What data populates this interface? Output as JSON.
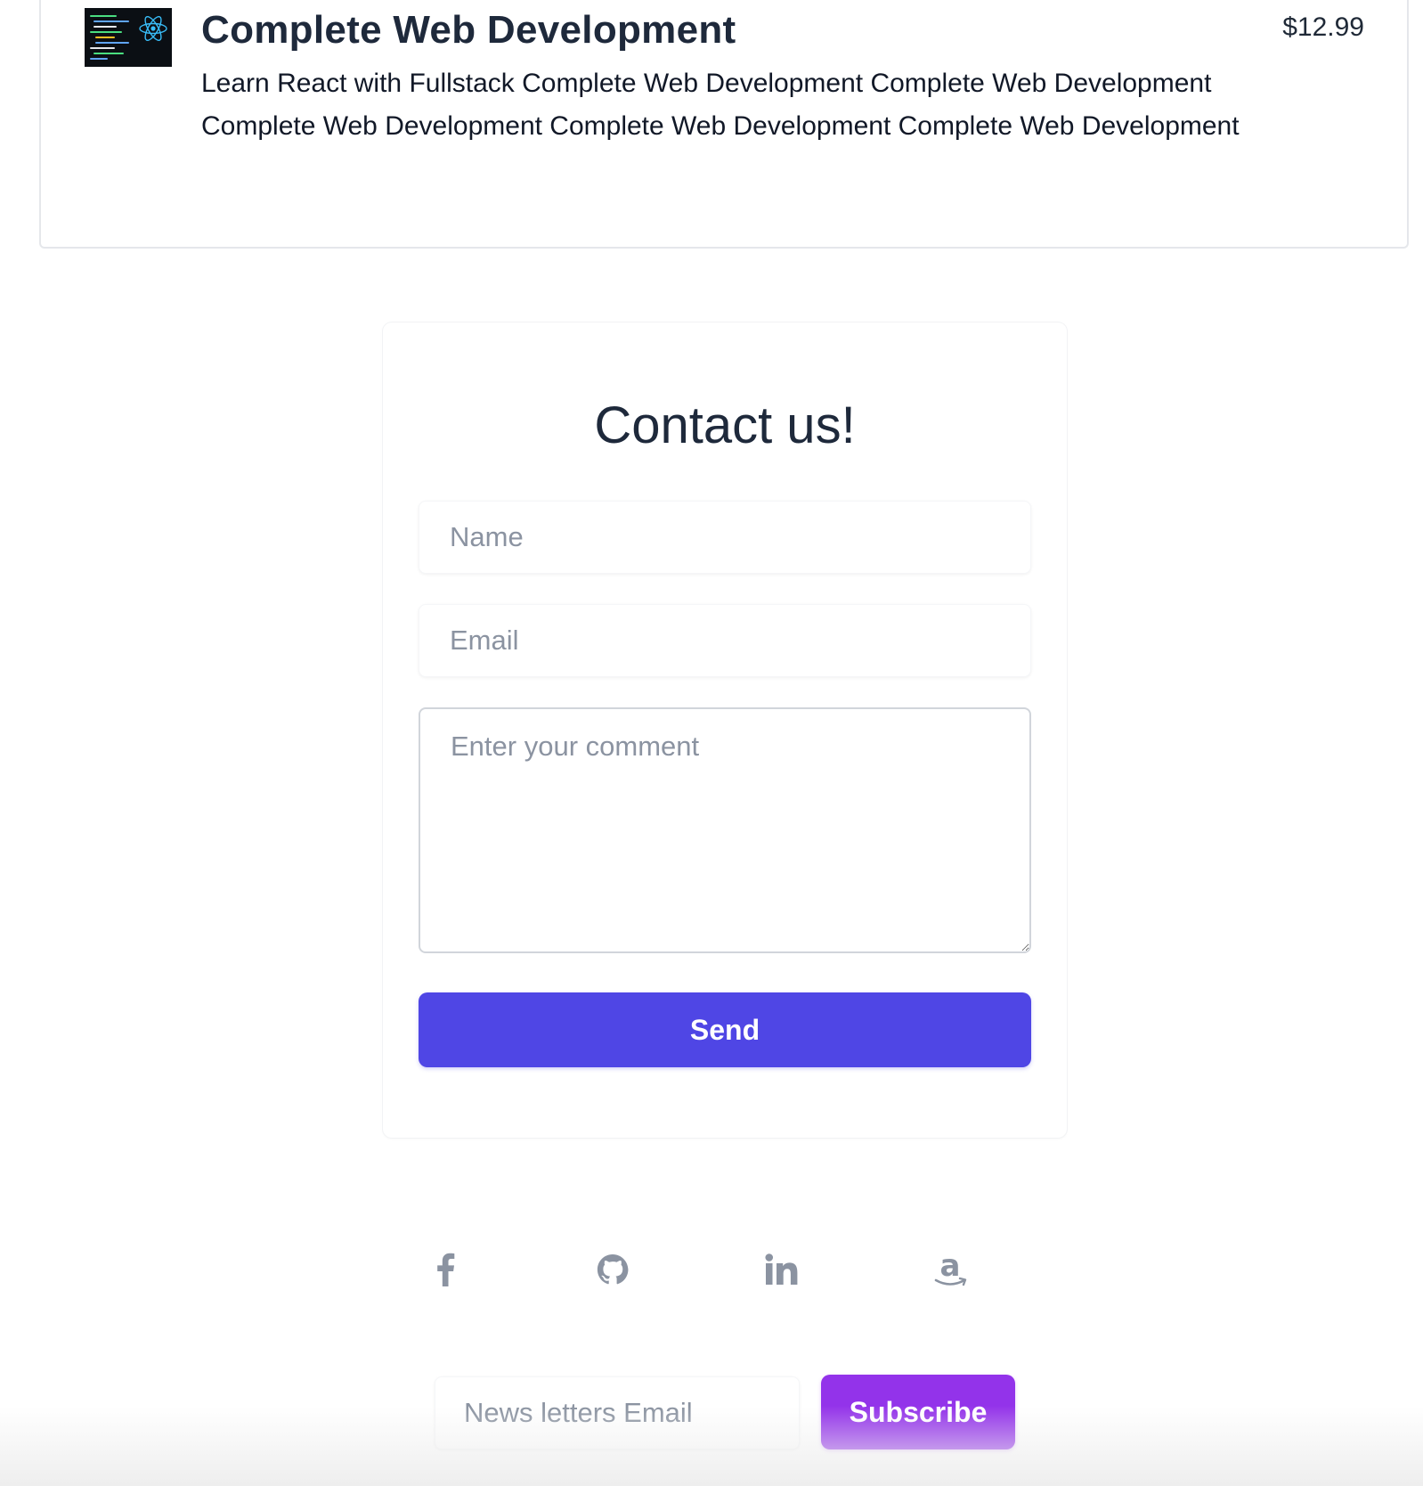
{
  "course": {
    "title": "Complete Web Development",
    "price": "$12.99",
    "description": "Learn React with Fullstack Complete Web Development Complete Web Development Complete Web Development Complete Web Development Complete Web Development",
    "thumbnail_icon": "react-code-thumbnail"
  },
  "contact": {
    "title": "Contact us!",
    "name_placeholder": "Name",
    "email_placeholder": "Email",
    "comment_placeholder": "Enter your comment",
    "send_label": "Send"
  },
  "social": {
    "icons": [
      "facebook-icon",
      "github-icon",
      "linkedin-icon",
      "amazon-icon"
    ],
    "color": "#8b93a1"
  },
  "newsletter": {
    "placeholder": "News letters Email",
    "subscribe_label": "Subscribe"
  },
  "colors": {
    "send_button": "#4f46e5",
    "subscribe_button": "#9333ea",
    "title_text": "#1e293b"
  }
}
